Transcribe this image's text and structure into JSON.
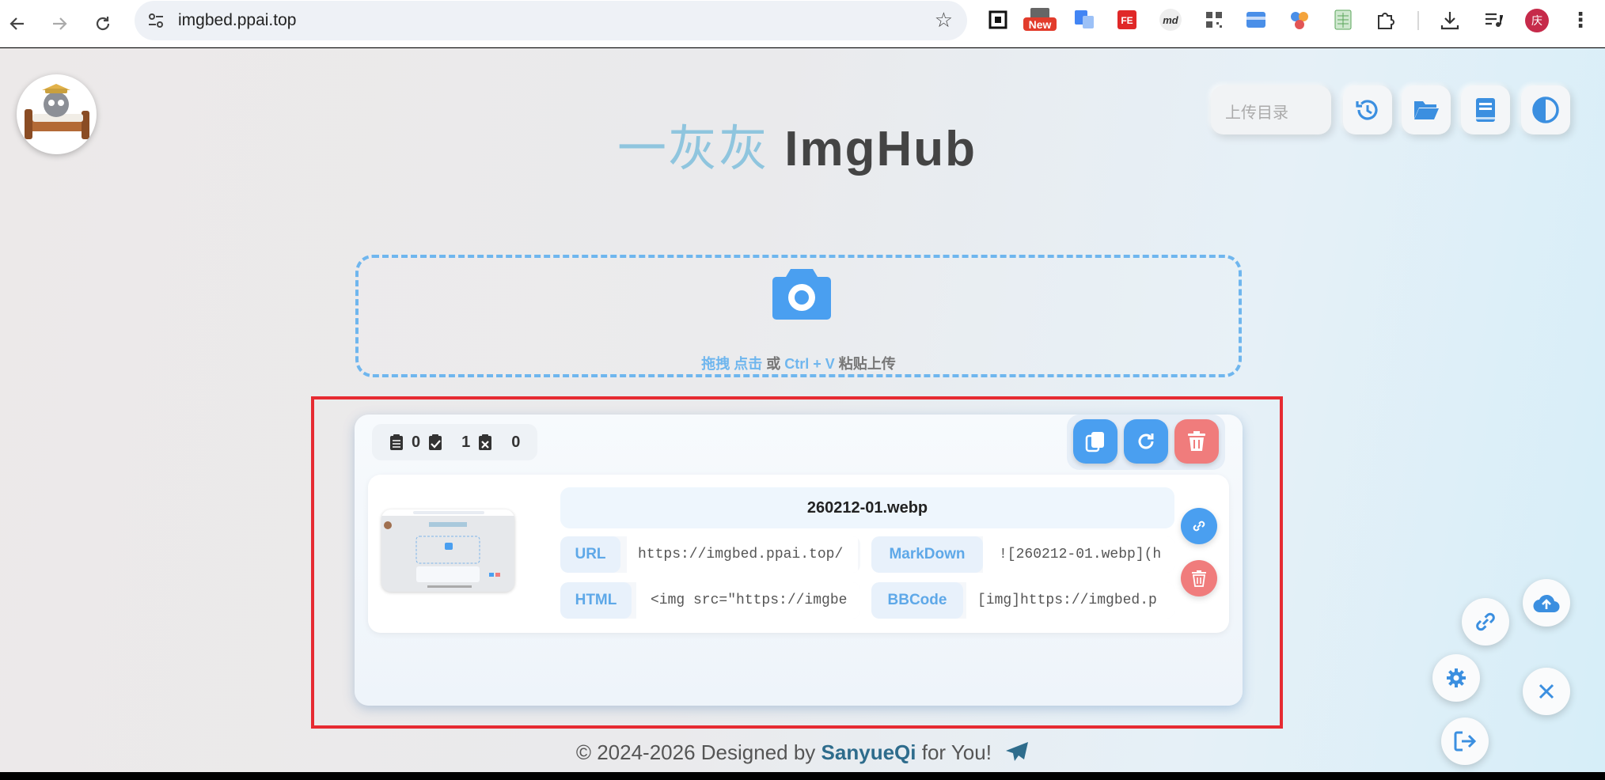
{
  "browser": {
    "url": "imgbed.ppai.top",
    "extensions": [
      "qr-ext-icon",
      "new-badge-ext",
      "translate-ext",
      "fe-ext",
      "md",
      "qr-code-ext",
      "card-ext",
      "users-ext",
      "sheet-ext",
      "puzzle-icon"
    ],
    "new_badge": "New",
    "fe_badge": "FE",
    "md_badge": "md",
    "profile_initial": "庆"
  },
  "header": {
    "title_cn": "一灰灰",
    "title_en": "ImgHub",
    "upload_dir_placeholder": "上传目录"
  },
  "dropzone": {
    "drag": "拖拽",
    "click": "点击",
    "or": "或",
    "shortcut": "Ctrl + V",
    "paste_upload": "粘贴上传"
  },
  "stats": {
    "pending": "0",
    "success": "1",
    "failed": "0"
  },
  "file": {
    "name": "260212-01.webp",
    "url_label": "URL",
    "url_value": "https://imgbed.ppai.top/",
    "markdown_label": "MarkDown",
    "markdown_value": "![260212-01.webp](h",
    "html_label": "HTML",
    "html_value": "<img src=\"https://imgbe",
    "bbcode_label": "BBCode",
    "bbcode_value": "[img]https://imgbed.p"
  },
  "footer": {
    "prefix": "© 2024-2026 Designed by",
    "author": "SanyueQi",
    "suffix": "for You!"
  },
  "colors": {
    "accent": "#4a9ff0",
    "danger": "#f07c7c",
    "highlight": "#e62b32"
  }
}
